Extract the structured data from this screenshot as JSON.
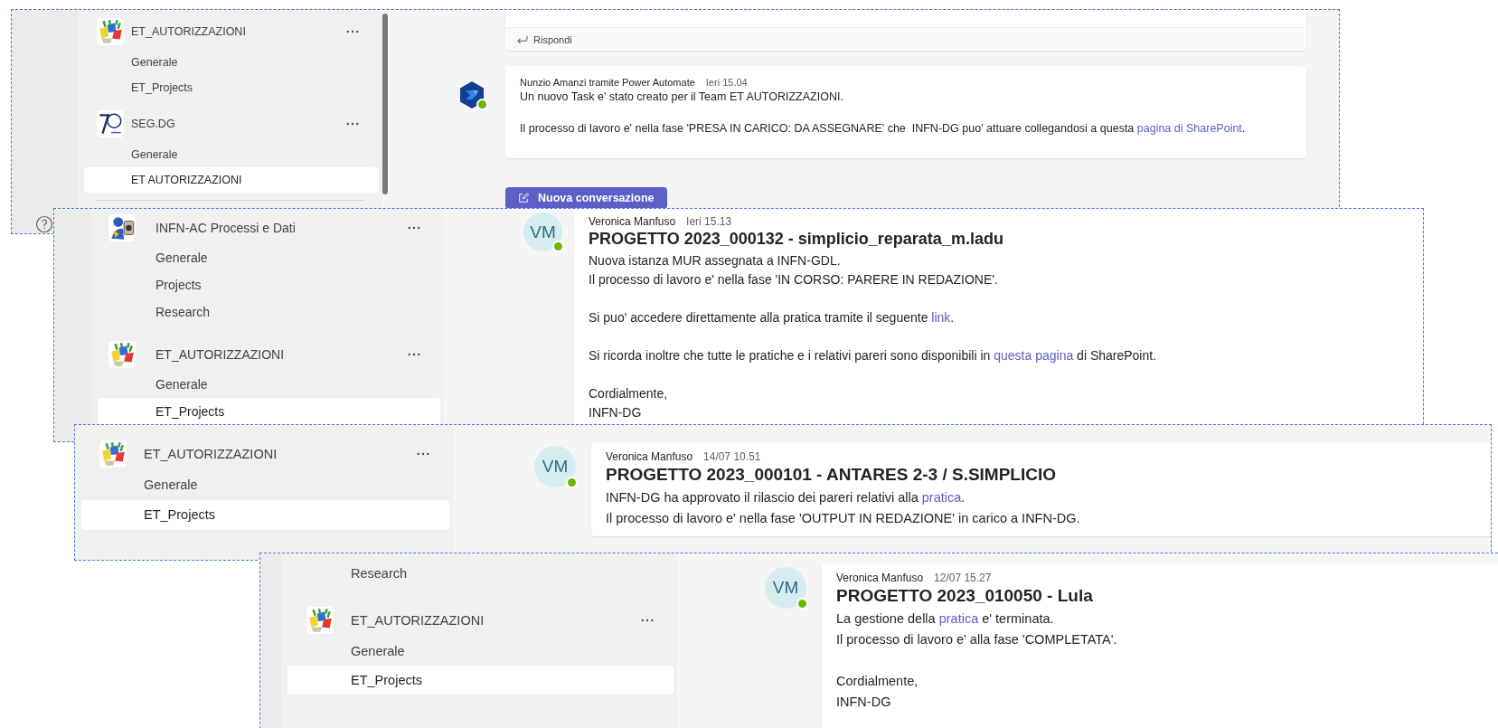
{
  "panels": [
    {
      "sidebar": [
        {
          "kind": "team",
          "name": "ET_AUTORIZZAZIONI",
          "logo": {
            "kind": "puzzle"
          },
          "children": [
            {
              "name": "Generale",
              "selected": false
            },
            {
              "name": "ET_Projects",
              "selected": false
            }
          ]
        },
        {
          "kind": "team",
          "name": "SEG.DG",
          "logo": {
            "kind": "badge"
          },
          "children": [
            {
              "name": "Generale",
              "selected": false
            },
            {
              "name": "ET AUTORIZZAZIONI",
              "selected": true
            }
          ]
        }
      ],
      "feed": [
        {
          "kind": "reply",
          "label": "Rispondi"
        },
        {
          "kind": "message",
          "avatar": {
            "kind": "bot"
          },
          "presence": {
            "kind": "available"
          },
          "author": "Nunzio Amanzi tramite Power Automate",
          "time": "Ieri 15.04",
          "paragraphs": [
            [
              [
                {
                  "kind": "text",
                  "text": "Un nuovo Task e' stato creato per il Team ET AUTORIZZAZIONI."
                }
              ]
            ],
            [
              [
                {
                  "kind": "text",
                  "text": "Il processo di lavoro e' nella fase 'PRESA IN CARICO: DA ASSEGNARE' che  INFN-DG puo' attuare collegandosi a questa "
                },
                {
                  "kind": "link",
                  "text": "pagina di SharePoint"
                },
                {
                  "kind": "text",
                  "text": "."
                }
              ]
            ]
          ]
        }
      ],
      "new_conversation_button": "Nuova conversazione"
    },
    {
      "sidebar": [
        {
          "kind": "team",
          "name": "INFN-AC Processi e Dati",
          "logo": {
            "kind": "cartoon"
          },
          "children": [
            {
              "name": "Generale",
              "selected": false
            },
            {
              "name": "Projects",
              "selected": false
            },
            {
              "name": "Research",
              "selected": false
            }
          ]
        },
        {
          "kind": "team",
          "name": "ET_AUTORIZZAZIONI",
          "logo": {
            "kind": "puzzle"
          },
          "children": [
            {
              "name": "Generale",
              "selected": false
            },
            {
              "name": "ET_Projects",
              "selected": true
            }
          ]
        }
      ],
      "feed": [
        {
          "kind": "message",
          "avatar": {
            "kind": "initials",
            "text": "VM"
          },
          "presence": {
            "kind": "available"
          },
          "author": "Veronica Manfuso",
          "time": "Ieri 15.13",
          "title": "PROGETTO 2023_000132 - simplicio_reparata_m.ladu",
          "paragraphs": [
            [
              [
                {
                  "kind": "text",
                  "text": "Nuova istanza MUR assegnata a INFN-GDL."
                }
              ],
              [
                {
                  "kind": "text",
                  "text": "Il processo di lavoro e' nella fase 'IN CORSO: PARERE IN REDAZIONE'."
                }
              ]
            ],
            [
              [
                {
                  "kind": "text",
                  "text": "Si puo' accedere direttamente alla pratica tramite il seguente "
                },
                {
                  "kind": "link",
                  "text": "link"
                },
                {
                  "kind": "text",
                  "text": "."
                }
              ]
            ],
            [
              [
                {
                  "kind": "text",
                  "text": "Si ricorda inoltre che tutte le pratiche e i relativi pareri sono disponibili in "
                },
                {
                  "kind": "link",
                  "text": "questa pagina"
                },
                {
                  "kind": "text",
                  "text": " di SharePoint."
                }
              ]
            ],
            [
              [
                {
                  "kind": "text",
                  "text": "Cordialmente,"
                }
              ],
              [
                {
                  "kind": "text",
                  "text": "INFN-DG"
                }
              ]
            ]
          ]
        }
      ]
    },
    {
      "sidebar": [
        {
          "kind": "team",
          "name": "ET_AUTORIZZAZIONI",
          "logo": {
            "kind": "puzzle"
          },
          "children": [
            {
              "name": "Generale",
              "selected": false
            },
            {
              "name": "ET_Projects",
              "selected": true
            }
          ]
        }
      ],
      "feed": [
        {
          "kind": "message",
          "avatar": {
            "kind": "initials",
            "text": "VM"
          },
          "presence": {
            "kind": "available"
          },
          "author": "Veronica Manfuso",
          "time": "14/07 10.51",
          "title": "PROGETTO 2023_000101 - ANTARES 2-3 / S.SIMPLICIO",
          "paragraphs": [
            [
              [
                {
                  "kind": "text",
                  "text": "INFN-DG ha approvato il rilascio dei pareri relativi alla "
                },
                {
                  "kind": "link",
                  "text": "pratica"
                },
                {
                  "kind": "text",
                  "text": "."
                }
              ],
              [
                {
                  "kind": "text",
                  "text": "Il processo di lavoro e' nella fase 'OUTPUT IN REDAZIONE' in carico a INFN-DG."
                }
              ]
            ]
          ]
        }
      ]
    },
    {
      "sidebar": [
        {
          "kind": "channel",
          "name": "Research",
          "selected": false
        },
        {
          "kind": "team",
          "name": "ET_AUTORIZZAZIONI",
          "logo": {
            "kind": "puzzle"
          },
          "children": [
            {
              "name": "Generale",
              "selected": false
            },
            {
              "name": "ET_Projects",
              "selected": true
            }
          ]
        }
      ],
      "feed": [
        {
          "kind": "message",
          "avatar": {
            "kind": "initials",
            "text": "VM"
          },
          "presence": {
            "kind": "available"
          },
          "author": "Veronica Manfuso",
          "time": "12/07 15.27",
          "title": "PROGETTO 2023_010050 - Lula",
          "paragraphs": [
            [
              [
                {
                  "kind": "text",
                  "text": "La gestione della "
                },
                {
                  "kind": "link",
                  "text": "pratica"
                },
                {
                  "kind": "text",
                  "text": " e' terminata."
                }
              ],
              [
                {
                  "kind": "text",
                  "text": "Il processo di lavoro e' alla fase 'COMPLETATA'."
                }
              ]
            ],
            [
              [
                {
                  "kind": "text",
                  "text": "Cordialmente,"
                }
              ],
              [
                {
                  "kind": "text",
                  "text": "INFN-DG"
                }
              ]
            ]
          ]
        }
      ]
    }
  ]
}
